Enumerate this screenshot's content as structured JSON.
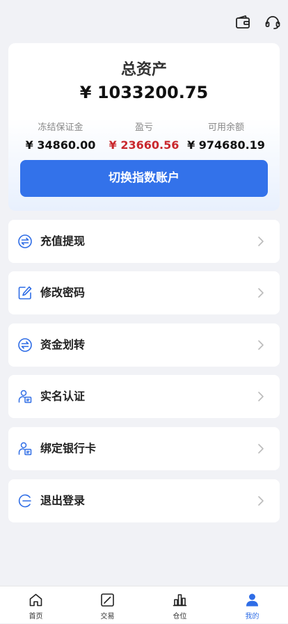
{
  "header": {
    "wallet_icon": "wallet-icon",
    "support_icon": "headset-icon"
  },
  "assets": {
    "title": "总资产",
    "total": "¥  1033200.75",
    "stats": [
      {
        "label": "冻结保证金",
        "value": "¥ 34860.00"
      },
      {
        "label": "盈亏",
        "value": "¥ 23660.56"
      },
      {
        "label": "可用余额",
        "value": "¥ 974680.19"
      }
    ],
    "switch_button": "切换指数账户"
  },
  "menu": [
    {
      "label": "充值提现",
      "icon": "exchange-icon"
    },
    {
      "label": "修改密码",
      "icon": "edit-icon"
    },
    {
      "label": "资金划转",
      "icon": "exchange-icon"
    },
    {
      "label": "实名认证",
      "icon": "id-badge-icon"
    },
    {
      "label": "绑定银行卡",
      "icon": "id-badge-icon"
    },
    {
      "label": "退出登录",
      "icon": "logout-icon"
    }
  ],
  "tabs": [
    {
      "label": "首页",
      "icon": "home-icon"
    },
    {
      "label": "交易",
      "icon": "trade-chart-icon"
    },
    {
      "label": "仓位",
      "icon": "bar-chart-icon"
    },
    {
      "label": "我的",
      "icon": "user-icon"
    }
  ],
  "colors": {
    "primary": "#3372ea",
    "loss_gain_red": "#c9282d",
    "active_tab": "#2f6de6",
    "background": "#f1f2f6"
  }
}
